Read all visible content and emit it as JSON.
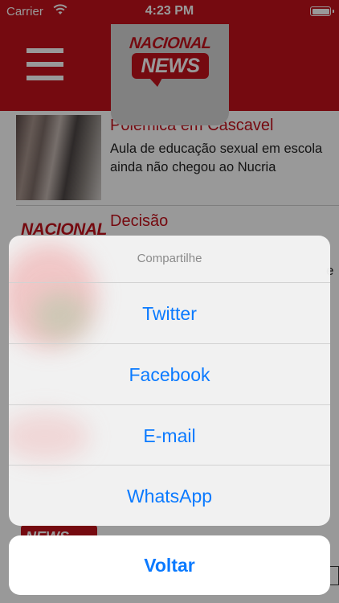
{
  "status_bar": {
    "carrier": "Carrier",
    "time": "4:23 PM"
  },
  "header": {
    "logo_line1": "NACIONAL",
    "logo_line2": "NEWS",
    "brand_color": "#c4111b"
  },
  "articles": [
    {
      "title": "Polêmica em Cascavel",
      "description": "Aula de educação sexual em escola ainda não chegou ao Nucria"
    },
    {
      "title": "Decisão",
      "thumb_text": "NACIONAL"
    }
  ],
  "bottom_thumb_text": "NEWS",
  "stray_char": "e",
  "share_sheet": {
    "title": "Compartilhe",
    "options": [
      "Twitter",
      "Facebook",
      "E-mail",
      "WhatsApp"
    ],
    "cancel_label": "Voltar",
    "accent_color": "#0a7aff"
  }
}
